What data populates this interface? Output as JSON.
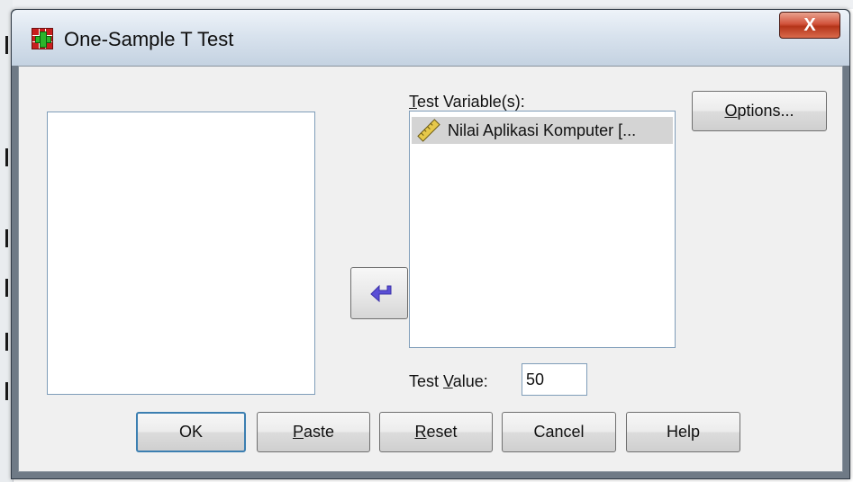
{
  "window": {
    "title": "One-Sample T Test",
    "close_glyph": "X"
  },
  "dialog": {
    "source_list": {
      "items": []
    },
    "move_button_icon": "arrow-left-icon",
    "test_variables": {
      "label_accel": "T",
      "label_rest": "est Variable(s):",
      "items": [
        {
          "label": "Nilai Aplikasi Komputer [...",
          "icon": "ruler-scale-icon"
        }
      ]
    },
    "test_value": {
      "label_pre": "Test ",
      "label_accel": "V",
      "label_rest": "alue:",
      "value": "50"
    },
    "buttons": {
      "options_accel": "O",
      "options_rest": "ptions...",
      "ok": "OK",
      "paste_accel": "P",
      "paste_rest": "aste",
      "reset_accel": "R",
      "reset_rest": "eset",
      "cancel": "Cancel",
      "help": "Help"
    }
  }
}
